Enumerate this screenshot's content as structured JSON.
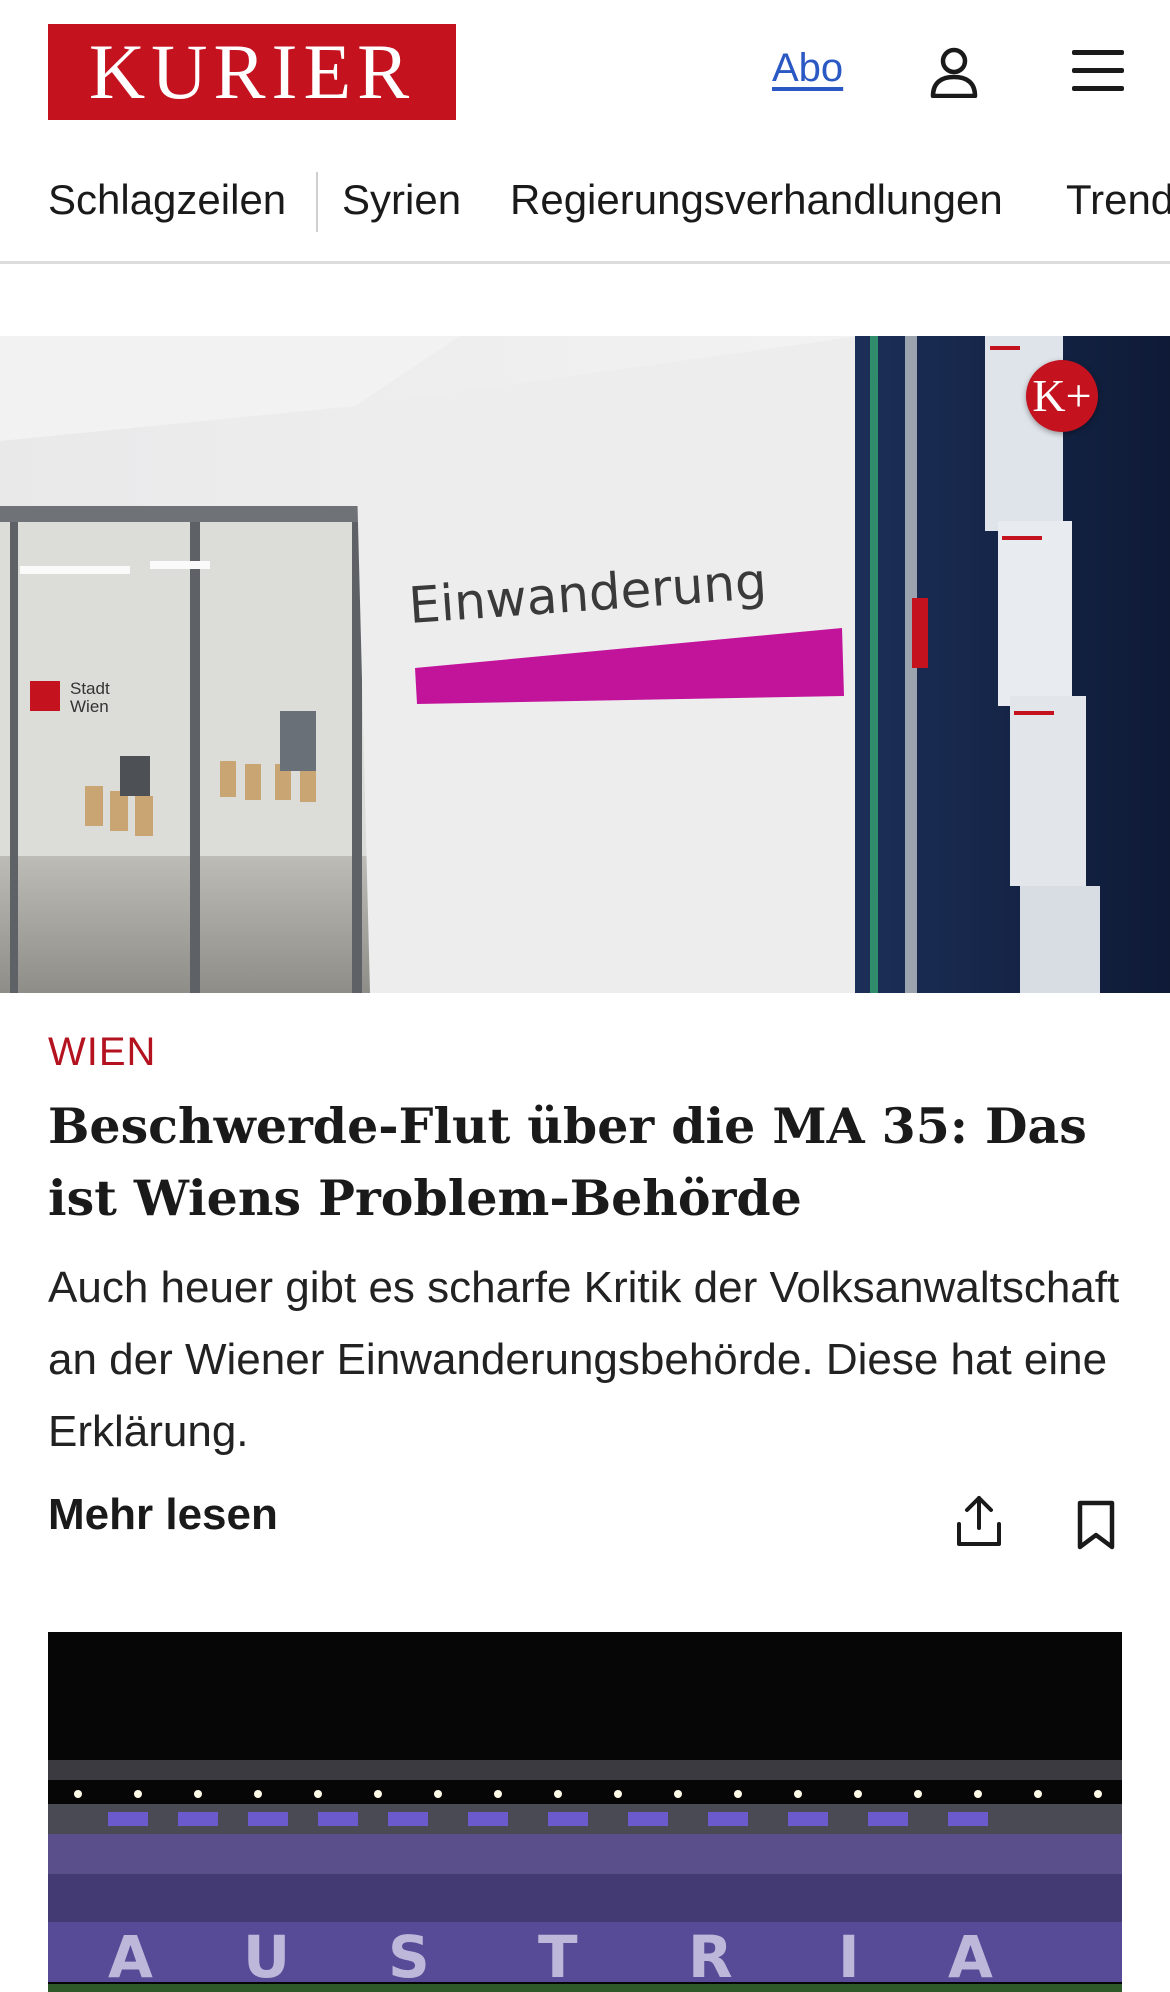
{
  "header": {
    "logo_text": "KURIER",
    "abo_label": "Abo",
    "user_icon": "user-icon",
    "menu_icon": "hamburger-menu-icon"
  },
  "nav": {
    "items": [
      {
        "label": "Schlagzeilen"
      },
      {
        "label": "Syrien"
      },
      {
        "label": "Regierungsverhandlungen"
      },
      {
        "label": "Trends"
      }
    ]
  },
  "hero": {
    "sign_text": "Einwanderung",
    "door_sign_line1": "Stadt",
    "door_sign_line2": "Wien",
    "badge_text": "K+"
  },
  "article": {
    "category": "WIEN",
    "headline": "Beschwerde-Flut über die MA 35: Das ist Wiens Problem-Behörde",
    "teaser": "Auch heuer gibt es scharfe Kritik der Volksanwaltschaft an der Wiener Einwanderungsbehörde. Diese hat eine Erklärung.",
    "read_more": "Mehr lesen",
    "share_icon": "share-icon",
    "bookmark_icon": "bookmark-icon"
  },
  "card2": {
    "stadium_letters": [
      "A",
      "U",
      "S",
      "T",
      "R",
      "I",
      "A"
    ]
  },
  "colors": {
    "brand_red": "#c4121f",
    "category_red": "#b4121f",
    "link_blue": "#2b59c3",
    "magenta_stripe": "#c2139b"
  }
}
